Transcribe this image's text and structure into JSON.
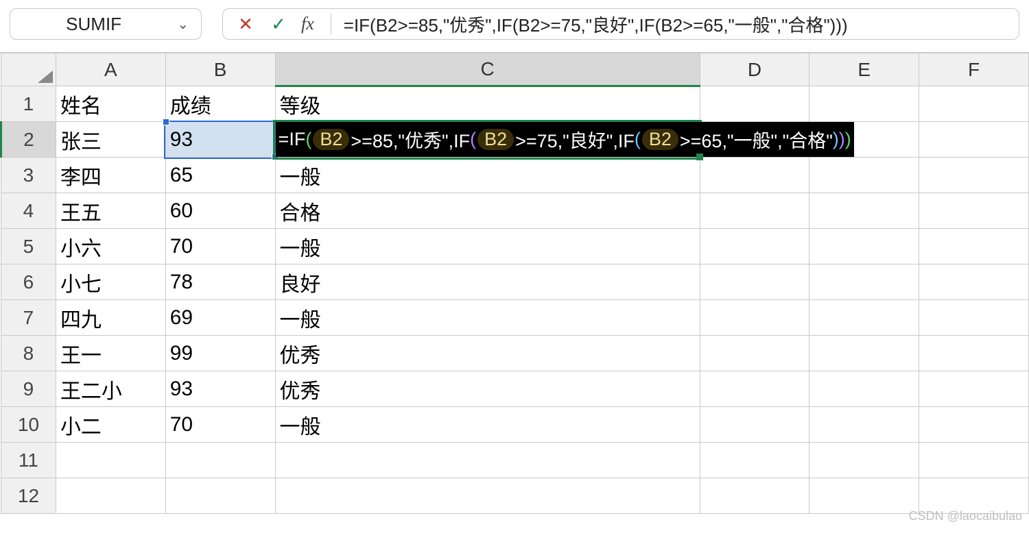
{
  "name_box": {
    "value": "SUMIF"
  },
  "formula_bar": {
    "formula": "=IF(B2>=85,\"优秀\",IF(B2>=75,\"良好\",IF(B2>=65,\"一般\",\"合格\")))",
    "cancel_icon": "✕",
    "confirm_icon": "✓",
    "fx_label": "fx"
  },
  "columns": [
    "A",
    "B",
    "C",
    "D",
    "E",
    "F"
  ],
  "headers": {
    "A": "姓名",
    "B": "成绩",
    "C": "等级"
  },
  "rows": [
    {
      "n": 1,
      "A": "姓名",
      "B": "成绩",
      "C": "等级"
    },
    {
      "n": 2,
      "A": "张三",
      "B": "93",
      "C_editing": true
    },
    {
      "n": 3,
      "A": "李四",
      "B": "65",
      "C": "一般"
    },
    {
      "n": 4,
      "A": "王五",
      "B": "60",
      "C": "合格"
    },
    {
      "n": 5,
      "A": "小六",
      "B": "70",
      "C": "一般"
    },
    {
      "n": 6,
      "A": "小七",
      "B": "78",
      "C": "良好"
    },
    {
      "n": 7,
      "A": "四九",
      "B": "69",
      "C": "一般"
    },
    {
      "n": 8,
      "A": "王一",
      "B": "99",
      "C": "优秀"
    },
    {
      "n": 9,
      "A": "王二小",
      "B": "93",
      "C": "优秀"
    },
    {
      "n": 10,
      "A": "小二",
      "B": "70",
      "C": "一般"
    },
    {
      "n": 11
    },
    {
      "n": 12
    }
  ],
  "edit_tokens": {
    "t0": "=IF",
    "ref": "B2",
    "t1": ">=85,\"优秀\",IF",
    "t2": ">=75,\"良好\",IF",
    "t3": ">=65,\"一般\",\"合格\"",
    "lp1": "(",
    "rp1": ")",
    "lp2": "(",
    "rp2": ")",
    "lp3": "(",
    "rp3": ")"
  },
  "watermark": "CSDN @laocaibulao",
  "active": {
    "col": "C",
    "row": 2
  }
}
